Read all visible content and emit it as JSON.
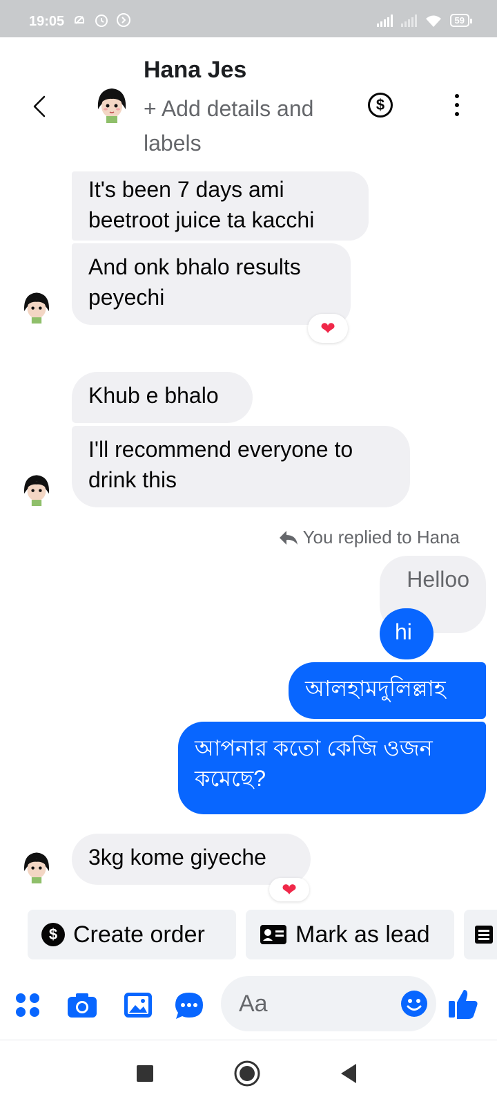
{
  "status_bar": {
    "time": "19:05",
    "battery": "59"
  },
  "header": {
    "name": "Hana Jes",
    "subtitle": "+ Add details and labels"
  },
  "messages": [
    {
      "text": "It's been 7 days ami beetroot juice ta kacchi"
    },
    {
      "text": "And onk bhalo results peyechi",
      "reaction": "❤"
    },
    {
      "text": "Khub e bhalo"
    },
    {
      "text": "I'll recommend everyone to drink this"
    },
    {
      "text": "Helloo"
    },
    {
      "text": "hi"
    },
    {
      "text": "আলহামদুলিল্লাহ"
    },
    {
      "text": "আপনার কতো কেজি ওজন কমেছে?"
    },
    {
      "text": "3kg kome giyeche",
      "reaction": "❤"
    }
  ],
  "reply_note": "You replied to Hana",
  "quick_actions": [
    {
      "label": "Create order"
    },
    {
      "label": "Mark as lead"
    }
  ],
  "composer": {
    "placeholder": "Aa"
  },
  "colors": {
    "accent": "#0866ff",
    "incoming_bubble": "#f0f0f3",
    "reaction": "#f02849"
  }
}
